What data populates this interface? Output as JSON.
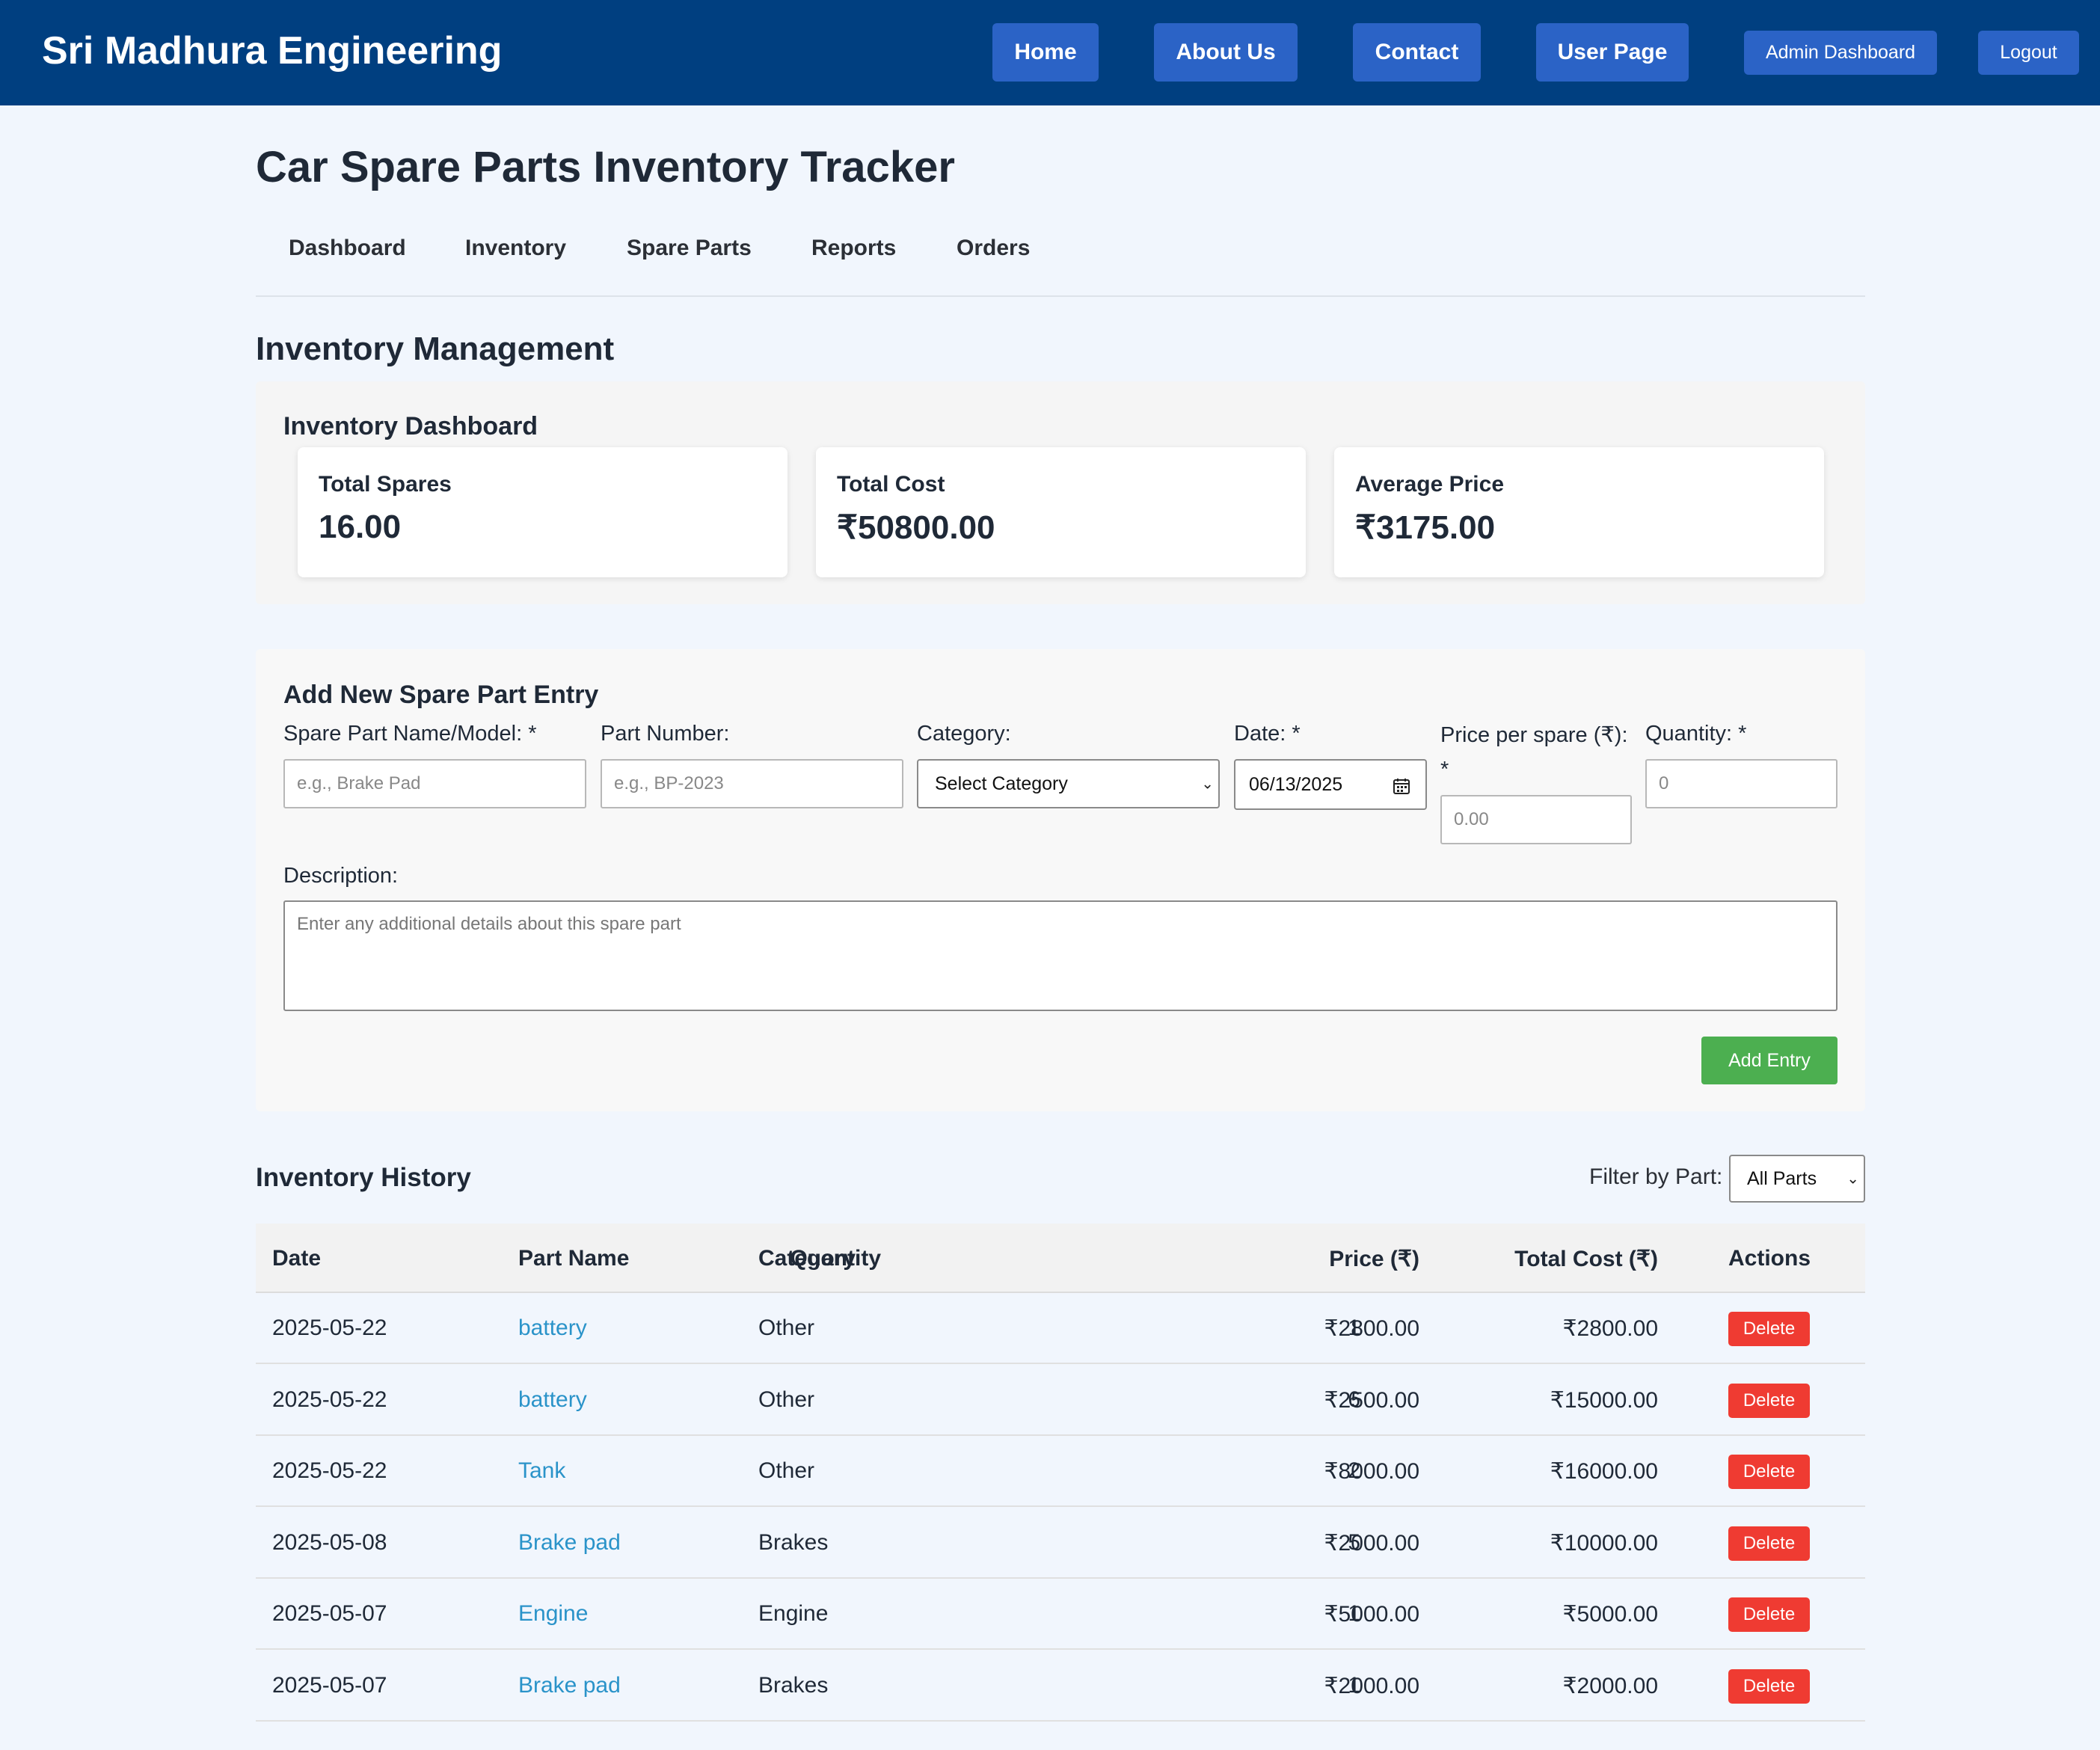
{
  "header": {
    "brand": "Sri Madhura Engineering",
    "nav": {
      "home": "Home",
      "about": "About Us",
      "contact": "Contact",
      "user_page": "User Page",
      "admin_dashboard": "Admin Dashboard",
      "logout": "Logout"
    }
  },
  "page": {
    "title": "Car Spare Parts Inventory Tracker",
    "tabs": [
      "Dashboard",
      "Inventory",
      "Spare Parts",
      "Reports",
      "Orders"
    ],
    "section_title": "Inventory Management"
  },
  "dashboard": {
    "title": "Inventory Dashboard",
    "cards": [
      {
        "label": "Total Spares",
        "value": "16.00"
      },
      {
        "label": "Total Cost",
        "value": "₹50800.00"
      },
      {
        "label": "Average Price",
        "value": "₹3175.00"
      }
    ]
  },
  "form": {
    "title": "Add New Spare Part Entry",
    "name_label": "Spare Part Name/Model: *",
    "name_placeholder": "e.g., Brake Pad",
    "number_label": "Part Number:",
    "number_placeholder": "e.g., BP-2023",
    "category_label": "Category:",
    "category_value": "Select Category",
    "date_label": "Date: *",
    "date_value": "06/13/2025",
    "price_label_line1": "Price per spare (₹):",
    "price_label_line2": "*",
    "price_placeholder": "0.00",
    "qty_label": "Quantity: *",
    "qty_placeholder": "0",
    "desc_label": "Description:",
    "desc_placeholder": "Enter any additional details about this spare part",
    "add_button": "Add Entry"
  },
  "history": {
    "title": "Inventory History",
    "filter_label": "Filter by Part:",
    "filter_value": "All Parts",
    "columns": {
      "date": "Date",
      "part": "Part Name",
      "category": "Category",
      "price": "Price (₹)",
      "qty": "Quantity",
      "total": "Total Cost (₹)",
      "actions": "Actions"
    },
    "delete_label": "Delete",
    "rows": [
      {
        "date": "2025-05-22",
        "part": "battery",
        "category": "Other",
        "price": "₹2800.00",
        "qty": "1",
        "total": "₹2800.00"
      },
      {
        "date": "2025-05-22",
        "part": "battery",
        "category": "Other",
        "price": "₹2500.00",
        "qty": "6",
        "total": "₹15000.00"
      },
      {
        "date": "2025-05-22",
        "part": "Tank",
        "category": "Other",
        "price": "₹8000.00",
        "qty": "2",
        "total": "₹16000.00"
      },
      {
        "date": "2025-05-08",
        "part": "Brake pad",
        "category": "Brakes",
        "price": "₹2000.00",
        "qty": "5",
        "total": "₹10000.00"
      },
      {
        "date": "2025-05-07",
        "part": "Engine",
        "category": "Engine",
        "price": "₹5000.00",
        "qty": "1",
        "total": "₹5000.00"
      },
      {
        "date": "2025-05-07",
        "part": "Brake pad",
        "category": "Brakes",
        "price": "₹2000.00",
        "qty": "1",
        "total": "₹2000.00"
      }
    ]
  }
}
